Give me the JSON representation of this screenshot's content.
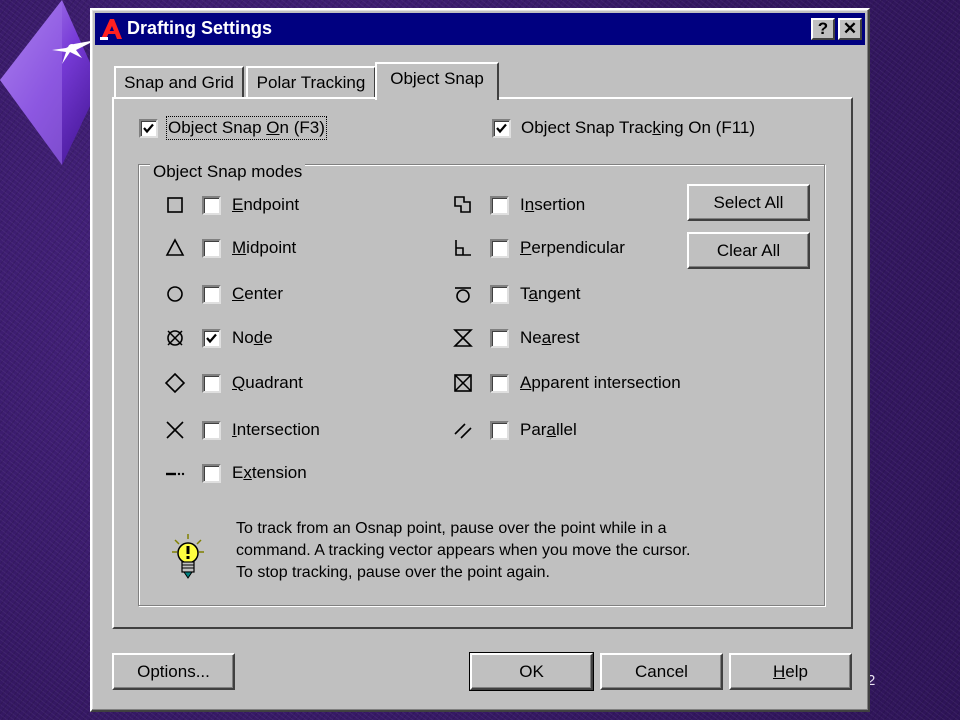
{
  "slide": {
    "number": "2"
  },
  "dialog": {
    "title": "Drafting Settings",
    "help_glyph": "?",
    "close_glyph": "✕"
  },
  "tabs": [
    {
      "label": "Snap and Grid",
      "active": false
    },
    {
      "label": "Polar Tracking",
      "active": false
    },
    {
      "label": "Object Snap",
      "active": true
    }
  ],
  "object_snap_on": {
    "label": "Object Snap On (F3)",
    "checked": true
  },
  "snap_tracking_on": {
    "label": "Object Snap Tracking On (F11)",
    "checked": true
  },
  "modes_group": {
    "legend": "Object Snap modes",
    "left": [
      {
        "icon": "endpoint-marker-icon",
        "label": "Endpoint",
        "checked": false
      },
      {
        "icon": "midpoint-marker-icon",
        "label": "Midpoint",
        "checked": false
      },
      {
        "icon": "center-marker-icon",
        "label": "Center",
        "checked": false
      },
      {
        "icon": "node-marker-icon",
        "label": "Node",
        "checked": true
      },
      {
        "icon": "quadrant-marker-icon",
        "label": "Quadrant",
        "checked": false
      },
      {
        "icon": "intersection-marker-icon",
        "label": "Intersection",
        "checked": false
      },
      {
        "icon": "extension-marker-icon",
        "label": "Extension",
        "checked": false
      }
    ],
    "right": [
      {
        "icon": "insertion-marker-icon",
        "label": "Insertion",
        "checked": false
      },
      {
        "icon": "perpendicular-marker-icon",
        "label": "Perpendicular",
        "checked": false
      },
      {
        "icon": "tangent-marker-icon",
        "label": "Tangent",
        "checked": false
      },
      {
        "icon": "nearest-marker-icon",
        "label": "Nearest",
        "checked": false
      },
      {
        "icon": "apparent-intersection-marker-icon",
        "label": "Apparent intersection",
        "checked": false
      },
      {
        "icon": "parallel-marker-icon",
        "label": "Parallel",
        "checked": false
      }
    ],
    "select_all": "Select All",
    "clear_all": "Clear All"
  },
  "tip": {
    "icon": "lightbulb-icon",
    "lines": [
      "To track from an Osnap point, pause over the point while in a",
      "command.  A tracking vector appears when you move the cursor.",
      "To stop tracking, pause over the point again."
    ]
  },
  "buttons": {
    "options": "Options...",
    "ok": "OK",
    "cancel": "Cancel",
    "help": "Help"
  },
  "colors": {
    "dialog_face": "#c0c0c0",
    "titlebar": "#000080",
    "desktop": "#3a1c6b"
  }
}
